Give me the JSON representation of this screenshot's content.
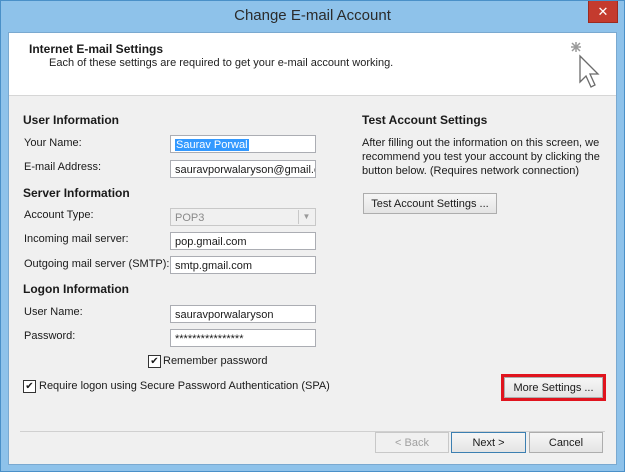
{
  "window": {
    "title": "Change E-mail Account",
    "close_label": "✕"
  },
  "header": {
    "title": "Internet E-mail Settings",
    "subtitle": "Each of these settings are required to get your e-mail account working.",
    "icon": "cursor-sparkle-icon"
  },
  "user_info": {
    "heading": "User Information",
    "name_label": "Your Name:",
    "name_value": "Saurav Porwal",
    "email_label": "E-mail Address:",
    "email_value": "sauravporwalaryson@gmail.cc"
  },
  "server_info": {
    "heading": "Server Information",
    "account_type_label": "Account Type:",
    "account_type_value": "POP3",
    "incoming_label": "Incoming mail server:",
    "incoming_value": "pop.gmail.com",
    "outgoing_label": "Outgoing mail server (SMTP):",
    "outgoing_value": "smtp.gmail.com"
  },
  "logon_info": {
    "heading": "Logon Information",
    "username_label": "User Name:",
    "username_value": "sauravporwalaryson",
    "password_label": "Password:",
    "password_value": "****************",
    "remember_label": "Remember password",
    "spa_label": "Require logon using Secure Password Authentication (SPA)"
  },
  "test": {
    "heading": "Test Account Settings",
    "description": "After filling out the information on this screen, we recommend you test your account by clicking the button below. (Requires network connection)",
    "button_label": "Test Account Settings ..."
  },
  "more_settings_label": "More Settings ...",
  "footer": {
    "back_label": "< Back",
    "next_label": "Next >",
    "cancel_label": "Cancel"
  },
  "colors": {
    "highlight": "#e0141e",
    "title_bar": "#8ec2ea"
  }
}
